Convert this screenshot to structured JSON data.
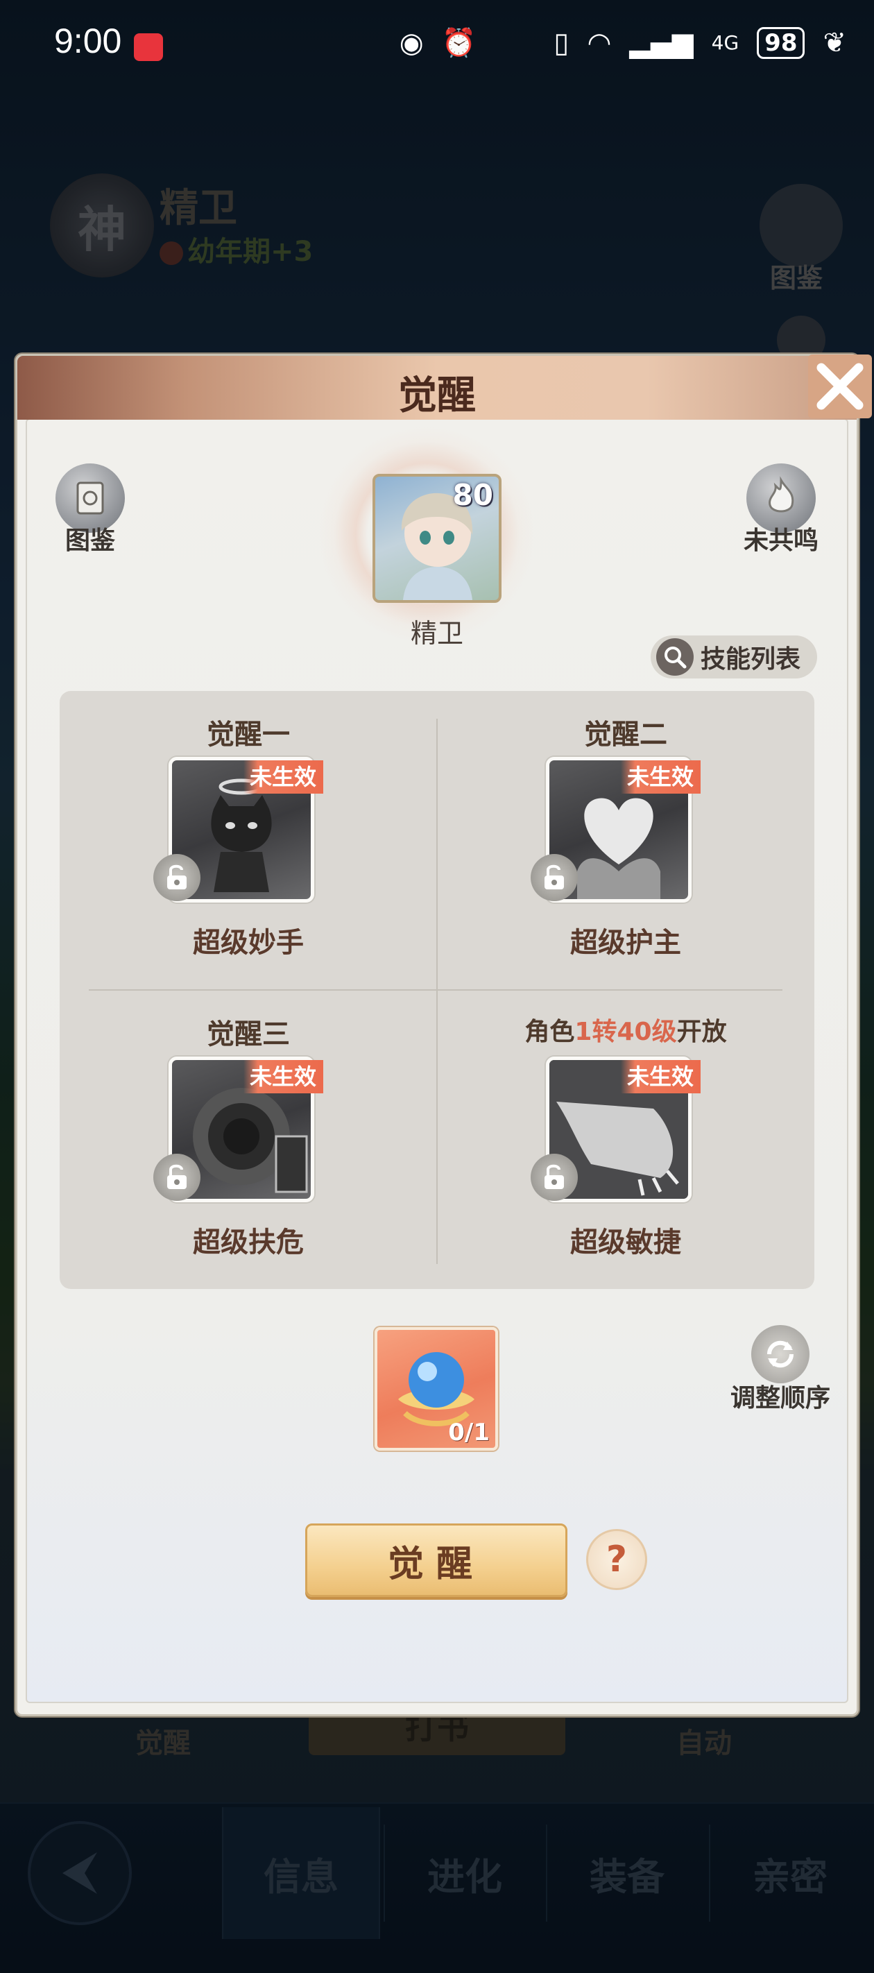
{
  "status_bar": {
    "time": "9:00",
    "network": "4G",
    "battery": "98"
  },
  "background": {
    "god_badge": "神",
    "hero_name": "精卫",
    "growth_stage": "幼年期+3",
    "atlas_label": "图鉴",
    "bottom_left_label": "觉醒",
    "bottom_center_label": "打书",
    "bottom_right_label": "自动"
  },
  "nav": {
    "tabs": [
      {
        "label": "信息"
      },
      {
        "label": "进化"
      },
      {
        "label": "装备"
      },
      {
        "label": "亲密"
      }
    ]
  },
  "dialog": {
    "title": "觉醒",
    "atlas_label": "图鉴",
    "resonance_label": "未共鸣",
    "hero": {
      "level": "80",
      "name": "精卫"
    },
    "skill_list_label": "技能列表",
    "awakenings": [
      {
        "title": "觉醒一",
        "badge": "未生效",
        "skill": "超级妙手"
      },
      {
        "title": "觉醒二",
        "badge": "未生效",
        "skill": "超级护主"
      },
      {
        "title": "觉醒三",
        "badge": "未生效",
        "skill": "超级扶危"
      },
      {
        "title_prefix": "角色",
        "title_highlight": "1转40级",
        "title_suffix": "开放",
        "badge": "未生效",
        "skill": "超级敏捷"
      }
    ],
    "item_count": "0/1",
    "reorder_label": "调整顺序",
    "awaken_button": "觉醒",
    "help_label": "?"
  }
}
